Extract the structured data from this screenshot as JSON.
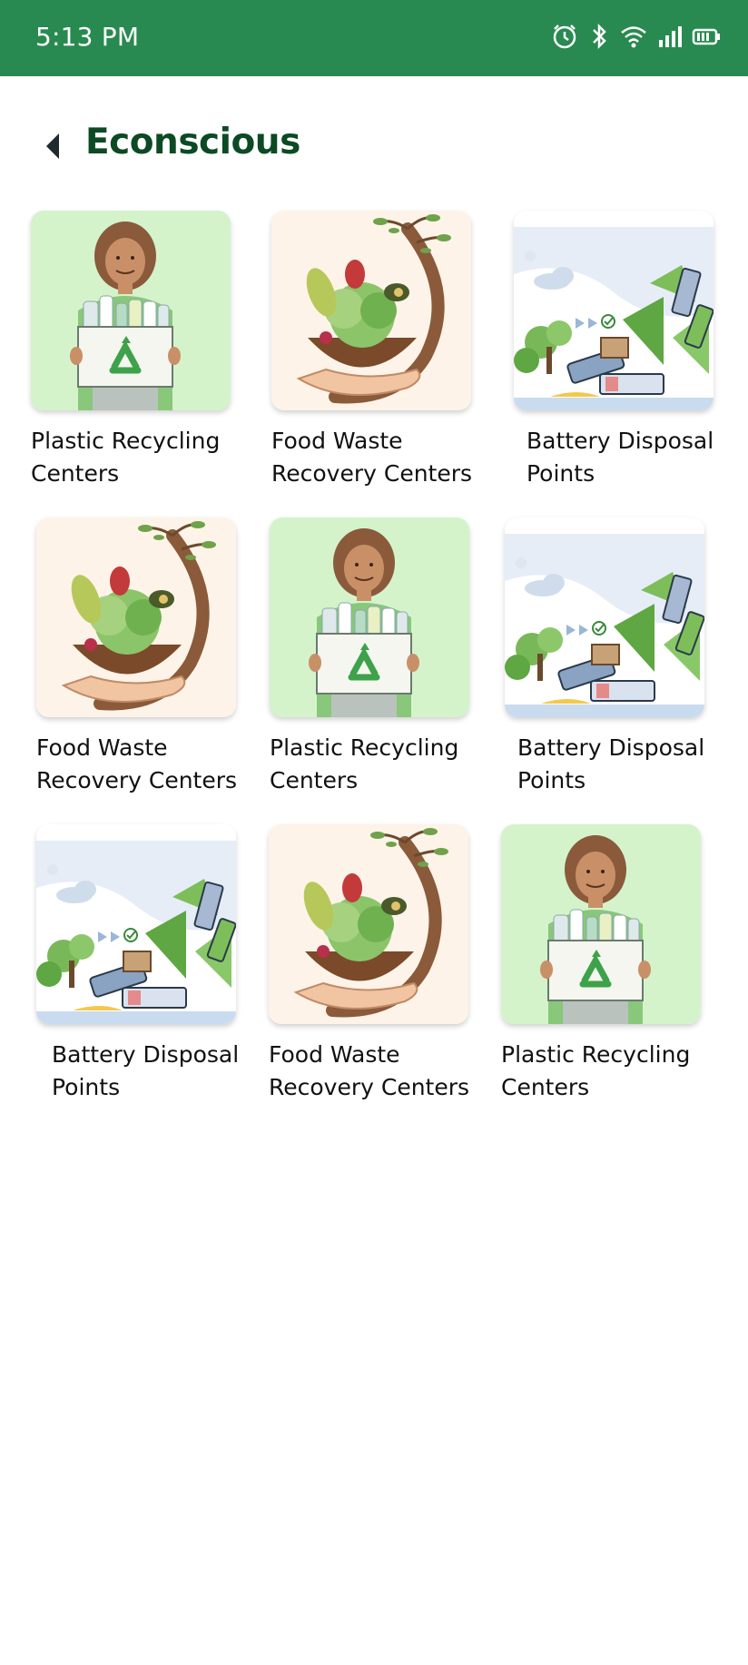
{
  "status_bar": {
    "time": "5:13 PM",
    "icons": [
      "alarm-icon",
      "bluetooth-icon",
      "wifi-icon",
      "signal-icon",
      "battery-icon"
    ]
  },
  "header": {
    "title": "Econscious",
    "back_icon": "back-arrow-icon"
  },
  "colors": {
    "status_bar": "#288a50",
    "title": "#0c4a24",
    "plastic_bg": "#d4f3cb",
    "food_bg": "#fdf3e8",
    "battery_bg": "#ffffff"
  },
  "grid": {
    "items": [
      {
        "label": "Plastic Recycling Centers",
        "type": "plastic"
      },
      {
        "label": "Food Waste Recovery Centers",
        "type": "food"
      },
      {
        "label": "Battery Disposal Points",
        "type": "battery"
      },
      {
        "label": "Food Waste Recovery Centers",
        "type": "food"
      },
      {
        "label": "Plastic Recycling Centers",
        "type": "plastic"
      },
      {
        "label": "Battery Disposal Points",
        "type": "battery"
      },
      {
        "label": "Battery Disposal Points",
        "type": "battery"
      },
      {
        "label": "Food Waste Recovery Centers",
        "type": "food"
      },
      {
        "label": "Plastic Recycling Centers",
        "type": "plastic"
      }
    ]
  }
}
